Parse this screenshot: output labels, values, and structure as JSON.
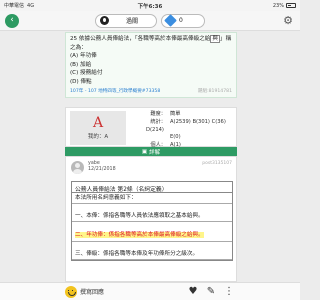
{
  "status_bar": {
    "carrier": "中華電信",
    "network": "4G",
    "time": "下午6:36",
    "battery": "23%"
  },
  "header": {
    "exam_label": "過關",
    "gem_count": "0"
  },
  "question": {
    "text_before": "25 依據公務人員俸給法，「各職等高於本俸最高俸級之給",
    "text_mark": "與",
    "text_after": "」稱之為：",
    "options": [
      "(A) 年功俸",
      "(B) 加給",
      "(C) 授務給付",
      "(D) 俸點"
    ],
    "meta_exam": "107年 - 107 地特四等_行政學概要#73358",
    "meta_id": "題組:81914781"
  },
  "answer": {
    "letter": "A",
    "my_label": "我的：A",
    "difficulty_label": "難度：",
    "difficulty_value": "簡單",
    "stats_label": "統計：",
    "stats_line1": "A(2539) B(301) C(36) D(214)",
    "stats_line2": "E(0)",
    "personal_label": "個人：",
    "personal_value": "A(1)"
  },
  "section_bar": {
    "label": "詳解"
  },
  "post": {
    "author": "yabe",
    "date": "12/21/2018",
    "post_id": "post3135107",
    "law_title": "公務人員俸給法 第2條（名詞定義）",
    "rows": [
      "本法所用名詞意義如下：",
      "一、本俸：係指各職等人員依法應領取之基本給與。",
      "二、年功俸：係指各職等高於本俸最高俸級之給與。",
      "三、俸級：係指各職等本俸及年功俸所分之級次。"
    ]
  },
  "bottom_bar": {
    "reply_label": "撰寫回應"
  }
}
